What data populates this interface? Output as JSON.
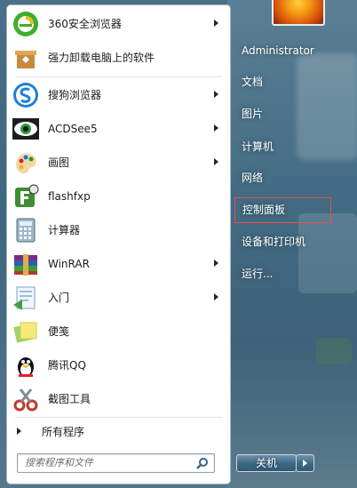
{
  "programs": [
    {
      "label": "360安全浏览器",
      "icon": "360-browser-icon",
      "has_submenu": true
    },
    {
      "label": "强力卸载电脑上的软件",
      "icon": "uninstall-icon",
      "has_submenu": false
    },
    {
      "label": "搜狗浏览器",
      "icon": "sogou-browser-icon",
      "has_submenu": true
    },
    {
      "label": "ACDSee5",
      "icon": "acdsee-icon",
      "has_submenu": true
    },
    {
      "label": "画图",
      "icon": "paint-icon",
      "has_submenu": true
    },
    {
      "label": "flashfxp",
      "icon": "flashfxp-icon",
      "has_submenu": false
    },
    {
      "label": "计算器",
      "icon": "calculator-icon",
      "has_submenu": false
    },
    {
      "label": "WinRAR",
      "icon": "winrar-icon",
      "has_submenu": true
    },
    {
      "label": "入门",
      "icon": "getting-started-icon",
      "has_submenu": true
    },
    {
      "label": "便笺",
      "icon": "sticky-notes-icon",
      "has_submenu": false
    },
    {
      "label": "腾讯QQ",
      "icon": "qq-icon",
      "has_submenu": false
    },
    {
      "label": "截图工具",
      "icon": "snipping-tool-icon",
      "has_submenu": false
    }
  ],
  "all_programs_label": "所有程序",
  "search": {
    "placeholder": "搜索程序和文件"
  },
  "right_items": [
    {
      "label": "Administrator",
      "selected": false
    },
    {
      "label": "文档",
      "selected": false
    },
    {
      "label": "图片",
      "selected": false
    },
    {
      "label": "计算机",
      "selected": false
    },
    {
      "label": "网络",
      "selected": false
    },
    {
      "label": "控制面板",
      "selected": true
    },
    {
      "label": "设备和打印机",
      "selected": false
    },
    {
      "label": "运行...",
      "selected": false
    }
  ],
  "shutdown_label": "关机",
  "colors": {
    "highlight_border": "#e84f4f",
    "panel_bg": "#ffffff"
  }
}
